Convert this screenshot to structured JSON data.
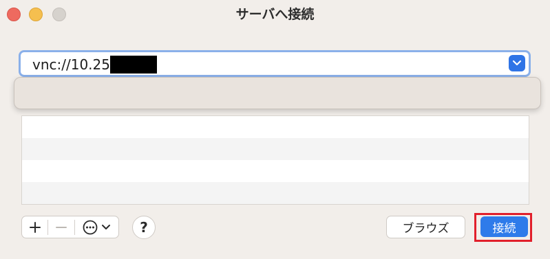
{
  "window": {
    "title": "サーバへ接続"
  },
  "server_address": {
    "value": "vnc://10.25",
    "redacted": true
  },
  "favorites": {
    "rows": [
      "",
      "",
      "",
      ""
    ]
  },
  "toolbar": {
    "add_icon": "plus-icon",
    "remove_icon": "minus-icon",
    "action_icon": "ellipsis-circle-icon",
    "help_label": "?"
  },
  "buttons": {
    "browse_label": "ブラウズ",
    "connect_label": "接続"
  },
  "colors": {
    "accent": "#2e7bea",
    "highlight": "#e11f2b"
  }
}
